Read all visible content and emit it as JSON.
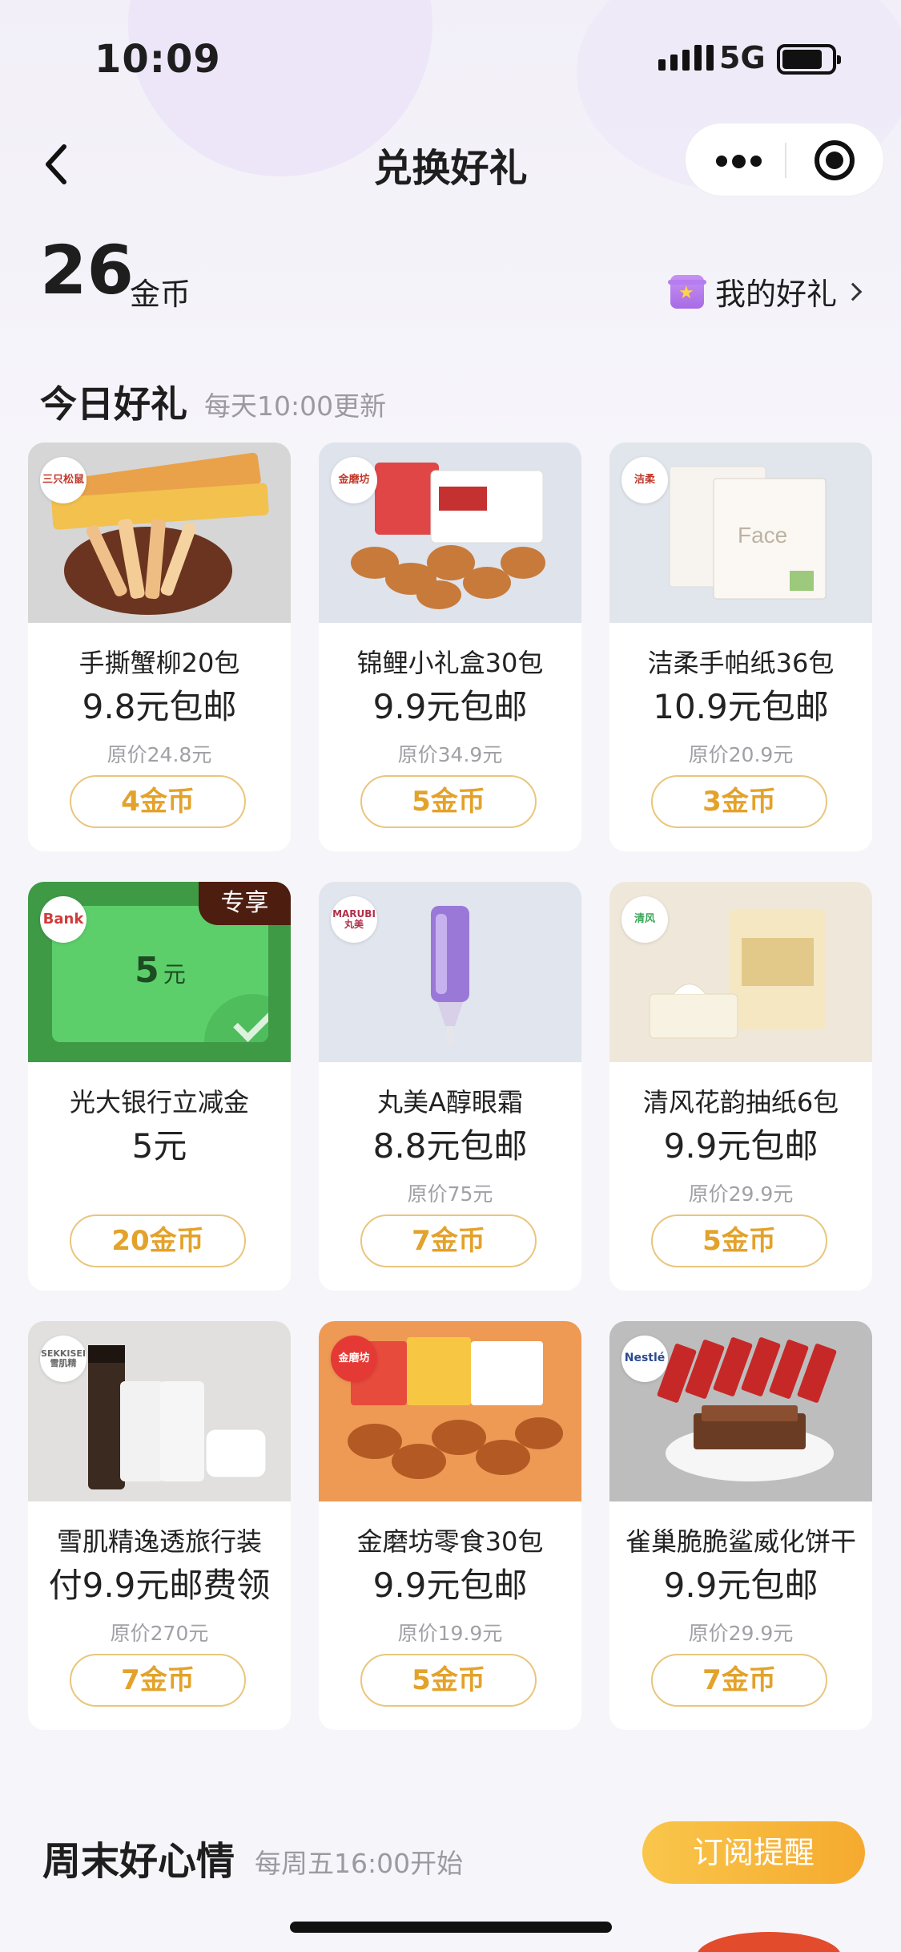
{
  "status_bar": {
    "time": "10:09",
    "network": "5G"
  },
  "nav": {
    "title": "兑换好礼"
  },
  "coins": {
    "amount": "26",
    "unit": "金币",
    "my_gifts_label": "我的好礼"
  },
  "today": {
    "title": "今日好礼",
    "subtitle": "每天10:00更新"
  },
  "products": [
    {
      "brand": "三只松鼠",
      "name": "手撕蟹柳20包",
      "price": "9.8元包邮",
      "original": "原价24.8元",
      "cost": "4金币"
    },
    {
      "brand": "金磨坊",
      "name": "锦鲤小礼盒30包",
      "price": "9.9元包邮",
      "original": "原价34.9元",
      "cost": "5金币"
    },
    {
      "brand": "洁柔",
      "name": "洁柔手帕纸36包",
      "price": "10.9元包邮",
      "original": "原价20.9元",
      "cost": "3金币"
    },
    {
      "brand": "Bank",
      "name": "光大银行立减金",
      "price": "5元",
      "original": "",
      "cost": "20金币",
      "badge": "专享",
      "card_value": "5",
      "card_unit": "元"
    },
    {
      "brand": "MARUBI 丸美",
      "name": "丸美A醇眼霜",
      "price": "8.8元包邮",
      "original": "原价75元",
      "cost": "7金币"
    },
    {
      "brand": "清风",
      "name": "清风花韵抽纸6包",
      "price": "9.9元包邮",
      "original": "原价29.9元",
      "cost": "5金币"
    },
    {
      "brand": "SEKKISEI 雪肌精",
      "name": "雪肌精逸透旅行装",
      "price": "付9.9元邮费领",
      "original": "原价270元",
      "cost": "7金币"
    },
    {
      "brand": "金磨坊",
      "name": "金磨坊零食30包",
      "price": "9.9元包邮",
      "original": "原价19.9元",
      "cost": "5金币"
    },
    {
      "brand": "Nestlé",
      "name": "雀巢脆脆鲨威化饼干",
      "price": "9.9元包邮",
      "original": "原价29.9元",
      "cost": "7金币"
    }
  ],
  "weekend": {
    "title": "周末好心情",
    "subtitle": "每周五16:00开始",
    "remind_label": "订阅提醒"
  },
  "colors": {
    "accent": "#e3a22b",
    "button_border": "#e9c67e",
    "remind": "#f5aa2e"
  }
}
